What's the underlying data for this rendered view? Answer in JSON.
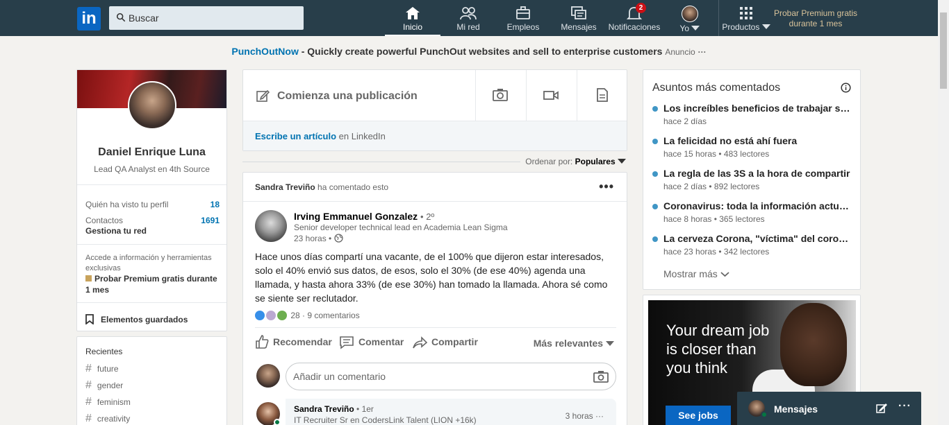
{
  "nav": {
    "logo": "in",
    "search_placeholder": "Buscar",
    "items": [
      {
        "label": "Inicio",
        "icon": "home-icon"
      },
      {
        "label": "Mi red",
        "icon": "network-icon"
      },
      {
        "label": "Empleos",
        "icon": "briefcase-icon"
      },
      {
        "label": "Mensajes",
        "icon": "messages-icon"
      },
      {
        "label": "Notificaciones",
        "icon": "bell-icon",
        "badge": "2"
      },
      {
        "label": "Yo",
        "icon": "avatar"
      },
      {
        "label": "Productos",
        "icon": "grid-icon"
      }
    ],
    "premium": "Probar Premium gratis durante 1 mes"
  },
  "ad": {
    "link": "PunchOutNow",
    "text": " - Quickly create powerful PunchOut websites and sell to enterprise customers",
    "label": "Anuncio",
    "more": "···"
  },
  "profile": {
    "name": "Daniel Enrique Luna",
    "title": "Lead QA Analyst en 4th Source",
    "viewed_label": "Quién ha visto tu perfil",
    "viewed_count": "18",
    "contacts_label": "Contactos",
    "contacts_count": "1691",
    "contacts_sub": "Gestiona tu red",
    "premium_text": "Accede a información y herramientas exclusivas",
    "premium_link": "Probar Premium gratis durante 1 mes",
    "saved": "Elementos guardados"
  },
  "recent": {
    "title": "Recientes",
    "tags": [
      "future",
      "gender",
      "feminism",
      "creativity"
    ]
  },
  "share": {
    "start": "Comienza una publicación",
    "article_link": "Escribe un artículo",
    "article_suffix": " en LinkedIn"
  },
  "sort": {
    "label": "Ordenar por:",
    "value": "Populares"
  },
  "post": {
    "header_name": "Sandra Treviño",
    "header_action": " ha comentado esto",
    "author": "Irving Emmanuel Gonzalez",
    "degree": "• 2º",
    "author_title": "Senior developer technical lead en Academia Lean Sigma",
    "time": "23 horas •",
    "text": "Hace unos días compartí una vacante, de el 100% que dijeron estar interesados, solo el 40% envió sus datos, de esos, solo el 30% (de ese 40%) agenda una llamada, y hasta ahora 33% (de ese 30%) han tomado la llamada. Ahora sé como se siente ser reclutador.",
    "reactions": "28 · 9 comentarios",
    "actions": {
      "like": "Recomendar",
      "comment": "Comentar",
      "share": "Compartir"
    },
    "relevance": "Más relevantes",
    "comment_placeholder": "Añadir un comentario",
    "comment": {
      "name": "Sandra Treviño",
      "degree": "• 1er",
      "title": "IT Recruiter Sr en CodersLink Talent (LION +16k)",
      "time": "3 horas ···"
    }
  },
  "topics": {
    "title": "Asuntos más comentados",
    "items": [
      {
        "title": "Los increíbles beneficios de trabajar seis horas",
        "meta": "hace 2 días"
      },
      {
        "title": "La felicidad no está ahí fuera",
        "meta": "hace 15 horas • 483 lectores"
      },
      {
        "title": "La regla de las 3S a la hora de compartir",
        "meta": "hace 2 días • 892 lectores"
      },
      {
        "title": "Coronavirus: toda la información actualizada",
        "meta": "hace 8 horas • 365 lectores"
      },
      {
        "title": "La cerveza Corona, \"víctima\" del coronavirus",
        "meta": "hace 23 horas • 342 lectores"
      }
    ],
    "more": "Mostrar más"
  },
  "adcard": {
    "headline": "Your dream job is closer than you think",
    "button": "See jobs"
  },
  "messaging": {
    "label": "Mensajes"
  }
}
